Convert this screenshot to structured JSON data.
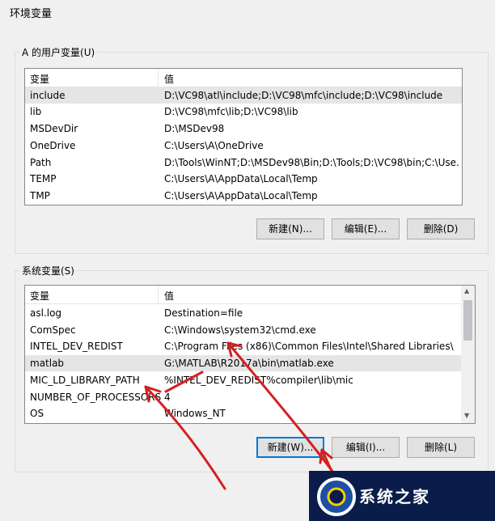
{
  "window": {
    "title": "环境变量"
  },
  "user_vars": {
    "group_label": "A 的用户变量(U)",
    "headers": [
      "变量",
      "值"
    ],
    "rows": [
      {
        "name": "include",
        "value": "D:\\VC98\\atl\\include;D:\\VC98\\mfc\\include;D:\\VC98\\include"
      },
      {
        "name": "lib",
        "value": "D:\\VC98\\mfc\\lib;D:\\VC98\\lib"
      },
      {
        "name": "MSDevDir",
        "value": "D:\\MSDev98"
      },
      {
        "name": "OneDrive",
        "value": "C:\\Users\\A\\OneDrive"
      },
      {
        "name": "Path",
        "value": "D:\\Tools\\WinNT;D:\\MSDev98\\Bin;D:\\Tools;D:\\VC98\\bin;C:\\Use..."
      },
      {
        "name": "TEMP",
        "value": "C:\\Users\\A\\AppData\\Local\\Temp"
      },
      {
        "name": "TMP",
        "value": "C:\\Users\\A\\AppData\\Local\\Temp"
      }
    ],
    "buttons": {
      "new": "新建(N)...",
      "edit": "编辑(E)...",
      "delete": "删除(D)"
    }
  },
  "system_vars": {
    "group_label": "系统变量(S)",
    "headers": [
      "变量",
      "值"
    ],
    "rows": [
      {
        "name": "asl.log",
        "value": "Destination=file"
      },
      {
        "name": "ComSpec",
        "value": "C:\\Windows\\system32\\cmd.exe"
      },
      {
        "name": "INTEL_DEV_REDIST",
        "value": "C:\\Program Files (x86)\\Common Files\\Intel\\Shared Libraries\\"
      },
      {
        "name": "matlab",
        "value": "G:\\MATLAB\\R2017a\\bin\\matlab.exe"
      },
      {
        "name": "MIC_LD_LIBRARY_PATH",
        "value": "%INTEL_DEV_REDIST%compiler\\lib\\mic"
      },
      {
        "name": "NUMBER_OF_PROCESSORS",
        "value": "4"
      },
      {
        "name": "OS",
        "value": "Windows_NT"
      }
    ],
    "buttons": {
      "new": "新建(W)...",
      "edit": "编辑(I)...",
      "delete": "删除(L)"
    }
  },
  "watermark": {
    "text": "系统之家",
    "top_text": "系统之家"
  },
  "colors": {
    "annotation_arrow": "#d42020",
    "selection": "#e5e5e5",
    "focus": "#0078d7"
  }
}
